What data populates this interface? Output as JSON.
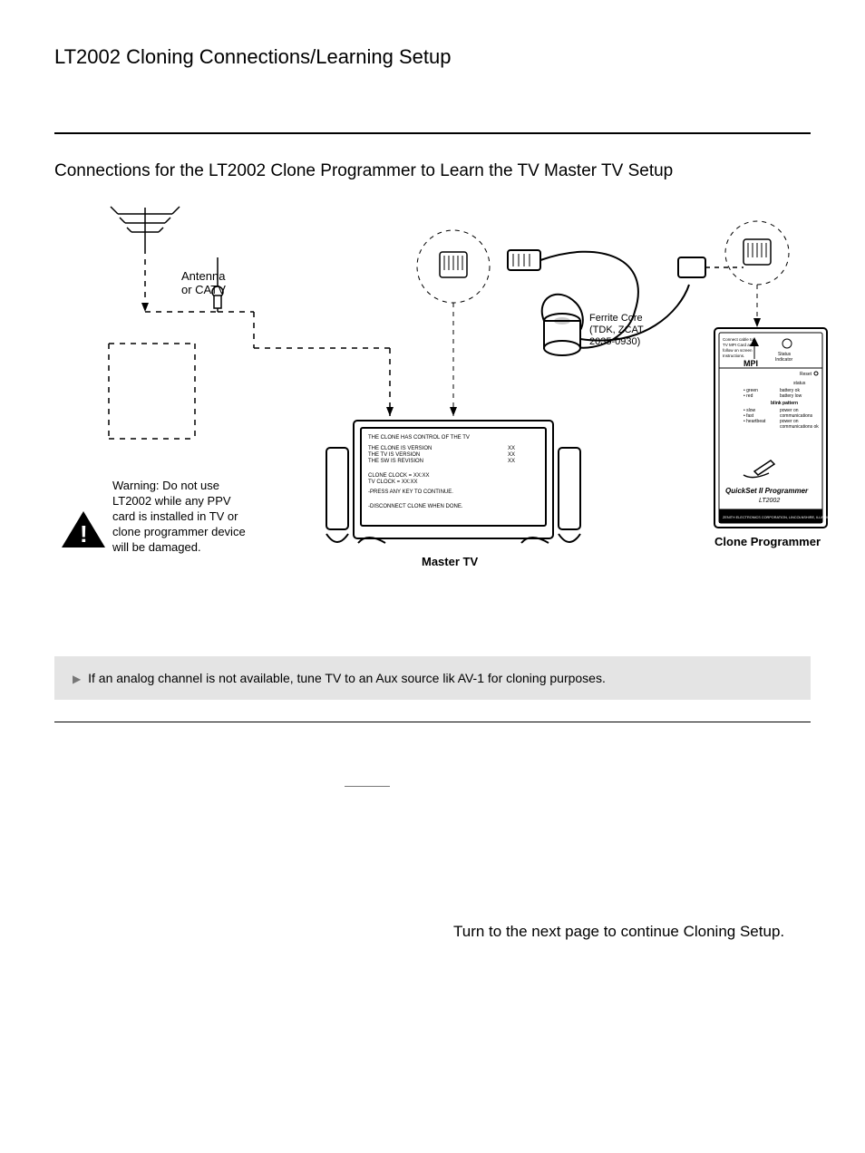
{
  "page_title": "LT2002 Cloning Connections/Learning Setup",
  "section_title": "Connections for the LT2002 Clone Programmer to Learn the TV Master TV Setup",
  "diagram": {
    "antenna_label_1": "Antenna",
    "antenna_label_2": "or CATV",
    "ferrite_1": "Ferrite Core",
    "ferrite_2": "(TDK, ZCAT",
    "ferrite_3": "2035-0930)",
    "mpi": "MPI",
    "status_indicator_1": "Status",
    "status_indicator_2": "Indicator",
    "device_note_1": "Connect cable to",
    "device_note_2": "TV MPI Card and",
    "device_note_3": "follow on screen",
    "device_note_4": "Instructions.",
    "reset": "Reset",
    "led_title": "status",
    "led_1a": "• green",
    "led_1b": "battery ok",
    "led_2a": "• red",
    "led_2b": "battery low",
    "led_mode": "blink pattern",
    "led_3a": "• slow",
    "led_3b": "power on",
    "led_4a": "• fast",
    "led_4b": "communications",
    "led_5a": "• heartbeat",
    "led_5b": "power on",
    "led_5c": "communications ok",
    "device_name_1": "QuickSet II Programmer",
    "device_name_2": "LT2002",
    "device_footer": "ZENITH ELECTRONICS CORPORATION, LINCOLNSHIRE, ILLINOIS USA",
    "tv_label": "Master TV",
    "cp_label": "Clone Programmer",
    "screen_l1": "THE CLONE HAS CONTROL OF THE TV",
    "screen_l2a": "THE CLONE IS VERSION",
    "screen_l2b": "XX",
    "screen_l3a": "THE TV IS VERSION",
    "screen_l3b": "XX",
    "screen_l4a": "THE SW IS REVISION",
    "screen_l4b": "XX",
    "screen_l5": "CLONE CLOCK   = XX:XX",
    "screen_l6": "TV CLOCK         = XX:XX",
    "screen_l7": "-PRESS ANY KEY TO CONTINUE.",
    "screen_l8": "-DISCONNECT CLONE WHEN DONE.",
    "warning_l1": "Warning: Do not use",
    "warning_l2": "LT2002 while any PPV",
    "warning_l3": "card is installed in TV or",
    "warning_l4": "clone programmer device",
    "warning_l5": "will be damaged."
  },
  "note_bullet": "If an analog channel is not available, tune TV to an Aux source lik AV-1 for cloning purposes.",
  "closing": "Turn to the next page to continue Cloning Setup."
}
